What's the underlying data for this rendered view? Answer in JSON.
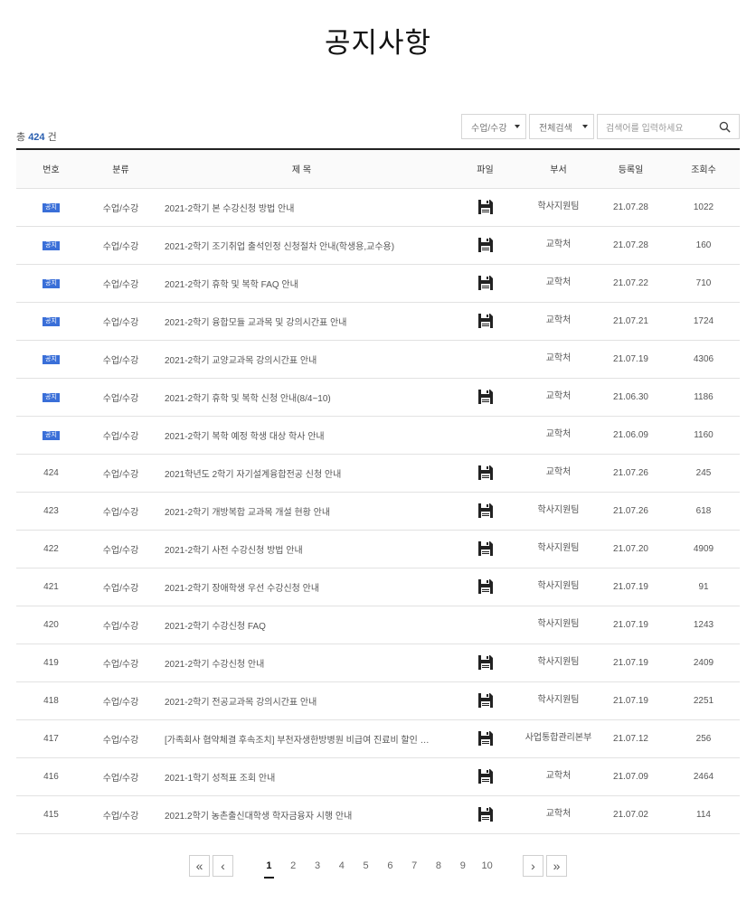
{
  "page_title": "공지사항",
  "total": {
    "prefix": "총",
    "count": "424",
    "suffix": "건"
  },
  "search": {
    "category": "수업/수강",
    "scope": "전체검색",
    "placeholder": "검색어를 입력하세요"
  },
  "columns": [
    "번호",
    "분류",
    "제 목",
    "파일",
    "부서",
    "등록일",
    "조회수"
  ],
  "notice_badge": "공지",
  "rows": [
    {
      "num": "",
      "notice": true,
      "cat": "수업/수강",
      "title": "2021-2학기 본 수강신청 방법 안내",
      "file": true,
      "dept": "학사지원팀",
      "date": "21.07.28",
      "views": "1022"
    },
    {
      "num": "",
      "notice": true,
      "cat": "수업/수강",
      "title": "2021-2학기 조기취업 출석인정 신청절차 안내(학생용,교수용)",
      "file": true,
      "dept": "교학처",
      "date": "21.07.28",
      "views": "160"
    },
    {
      "num": "",
      "notice": true,
      "cat": "수업/수강",
      "title": "2021-2학기 휴학 및 복학 FAQ 안내",
      "file": true,
      "dept": "교학처",
      "date": "21.07.22",
      "views": "710"
    },
    {
      "num": "",
      "notice": true,
      "cat": "수업/수강",
      "title": "2021-2학기 융합모듈 교과목 및 강의시간표 안내",
      "file": true,
      "dept": "교학처",
      "date": "21.07.21",
      "views": "1724"
    },
    {
      "num": "",
      "notice": true,
      "cat": "수업/수강",
      "title": "2021-2학기 교양교과목 강의시간표 안내",
      "file": false,
      "dept": "교학처",
      "date": "21.07.19",
      "views": "4306"
    },
    {
      "num": "",
      "notice": true,
      "cat": "수업/수강",
      "title": "2021-2학기 휴학 및 복학 신청 안내(8/4~10)",
      "file": true,
      "dept": "교학처",
      "date": "21.06.30",
      "views": "1186"
    },
    {
      "num": "",
      "notice": true,
      "cat": "수업/수강",
      "title": "2021-2학기 복학 예정 학생 대상 학사 안내",
      "file": false,
      "dept": "교학처",
      "date": "21.06.09",
      "views": "1160"
    },
    {
      "num": "424",
      "notice": false,
      "cat": "수업/수강",
      "title": "2021학년도 2학기 자기설계융합전공 신청 안내",
      "file": true,
      "dept": "교학처",
      "date": "21.07.26",
      "views": "245"
    },
    {
      "num": "423",
      "notice": false,
      "cat": "수업/수강",
      "title": "2021-2학기 개방복합 교과목 개설 현황 안내",
      "file": true,
      "dept": "학사지원팀",
      "date": "21.07.26",
      "views": "618"
    },
    {
      "num": "422",
      "notice": false,
      "cat": "수업/수강",
      "title": "2021-2학기 사전 수강신청 방법 안내",
      "file": true,
      "dept": "학사지원팀",
      "date": "21.07.20",
      "views": "4909"
    },
    {
      "num": "421",
      "notice": false,
      "cat": "수업/수강",
      "title": "2021-2학기 장애학생 우선 수강신청 안내",
      "file": true,
      "dept": "학사지원팀",
      "date": "21.07.19",
      "views": "91"
    },
    {
      "num": "420",
      "notice": false,
      "cat": "수업/수강",
      "title": "2021-2학기 수강신청 FAQ",
      "file": false,
      "dept": "학사지원팀",
      "date": "21.07.19",
      "views": "1243"
    },
    {
      "num": "419",
      "notice": false,
      "cat": "수업/수강",
      "title": "2021-2학기 수강신청 안내",
      "file": true,
      "dept": "학사지원팀",
      "date": "21.07.19",
      "views": "2409"
    },
    {
      "num": "418",
      "notice": false,
      "cat": "수업/수강",
      "title": "2021-2학기 전공교과목 강의시간표 안내",
      "file": true,
      "dept": "학사지원팀",
      "date": "21.07.19",
      "views": "2251"
    },
    {
      "num": "417",
      "notice": false,
      "cat": "수업/수강",
      "title": "[가족회사 협약체결 후속조치] 부천자생한방병원 비급여 진료비 할인 …",
      "file": true,
      "dept": "사업통합관리본부",
      "date": "21.07.12",
      "views": "256"
    },
    {
      "num": "416",
      "notice": false,
      "cat": "수업/수강",
      "title": "2021-1학기 성적표 조회 안내",
      "file": true,
      "dept": "교학처",
      "date": "21.07.09",
      "views": "2464"
    },
    {
      "num": "415",
      "notice": false,
      "cat": "수업/수강",
      "title": "2021.2학기 농촌출신대학생 학자금융자 시행 안내",
      "file": true,
      "dept": "교학처",
      "date": "21.07.02",
      "views": "114"
    }
  ],
  "pagination": {
    "first": "«",
    "prev": "‹",
    "next": "›",
    "last": "»",
    "pages": [
      "1",
      "2",
      "3",
      "4",
      "5",
      "6",
      "7",
      "8",
      "9",
      "10"
    ],
    "current": "1"
  },
  "icons": {
    "file": "floppy-disk-icon",
    "search": "search-icon"
  },
  "colors": {
    "accent": "#2a5fb0",
    "badge": "#3a6fd8"
  }
}
